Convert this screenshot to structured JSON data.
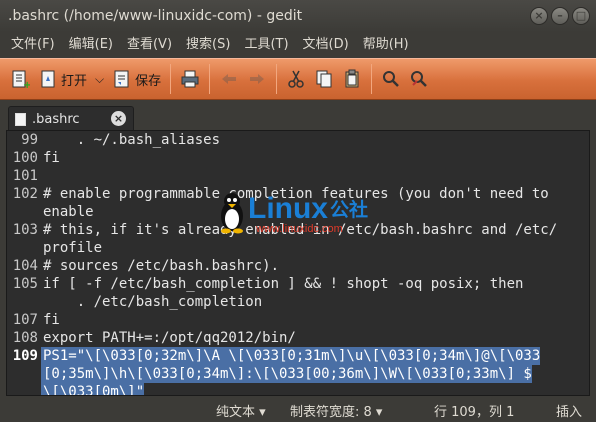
{
  "window": {
    "title": ".bashrc (/home/www-linuxidc-com) - gedit",
    "buttons": [
      "×",
      "–",
      "□"
    ]
  },
  "menu": [
    "文件(F)",
    "编辑(E)",
    "查看(V)",
    "搜索(S)",
    "工具(T)",
    "文档(D)",
    "帮助(H)"
  ],
  "toolbar": {
    "open_label": "打开",
    "save_label": "保存"
  },
  "tab": {
    "label": ".bashrc",
    "close": "×"
  },
  "editor": {
    "lines": [
      {
        "num": "99",
        "text": "    . ~/.bash_aliases"
      },
      {
        "num": "100",
        "text": "fi"
      },
      {
        "num": "101",
        "text": ""
      },
      {
        "num": "102",
        "text": "# enable programmable completion features (you don't need to"
      },
      {
        "num": "",
        "text": "enable"
      },
      {
        "num": "103",
        "text": "# this, if it's already enabled in /etc/bash.bashrc and /etc/"
      },
      {
        "num": "",
        "text": "profile"
      },
      {
        "num": "104",
        "text": "# sources /etc/bash.bashrc)."
      },
      {
        "num": "105",
        "text": "if [ -f /etc/bash_completion ] && ! shopt -oq posix; then"
      },
      {
        "num": "",
        "text": "    . /etc/bash_completion"
      },
      {
        "num": "107",
        "text": "fi"
      },
      {
        "num": "108",
        "text": "export PATH+=:/opt/qq2012/bin/"
      }
    ],
    "current_line": {
      "num": "109",
      "wrapped": [
        "PS1=\"\\[\\033[0;32m\\]\\A \\[\\033[0;31m\\]\\u\\[\\033[0;34m\\]@\\[\\033",
        "[0;35m\\]\\h\\[\\033[0;34m\\]:\\[\\033[00;36m\\]\\W\\[\\033[0;33m\\] $",
        "\\[\\033[0m\\]\""
      ]
    }
  },
  "watermark": {
    "text": "Linux",
    "cn": "公社",
    "url": "www.linuxidc.com"
  },
  "status": {
    "syntax": "纯文本 ▾",
    "tab_width": "制表符宽度: 8 ▾",
    "position": "行 109，列 1",
    "mode": "插入"
  },
  "colors": {
    "toolbar": "#d8703c",
    "selection": "#4a6fa5",
    "editor_bg": "#2d2d2d",
    "watermark_blue": "#1a7fd6"
  }
}
